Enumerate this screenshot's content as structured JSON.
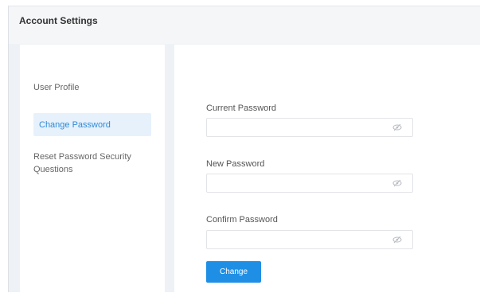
{
  "header": {
    "title": "Account Settings"
  },
  "sidebar": {
    "items": [
      {
        "label": "User Profile",
        "active": false
      },
      {
        "label": "Change Password",
        "active": true
      },
      {
        "label": "Reset Password Security Questions",
        "active": false
      }
    ]
  },
  "form": {
    "fields": [
      {
        "label": "Current Password",
        "value": "",
        "icon": "eye-slash-icon"
      },
      {
        "label": "New Password",
        "value": "",
        "icon": "eye-slash-icon"
      },
      {
        "label": "Confirm Password",
        "value": "",
        "icon": "eye-slash-icon"
      }
    ],
    "submit_label": "Change"
  },
  "colors": {
    "accent": "#1f8fe5",
    "active_nav_bg": "#e6f1fb",
    "active_nav_text": "#2f8ad6",
    "page_bg": "#eef1f5"
  }
}
